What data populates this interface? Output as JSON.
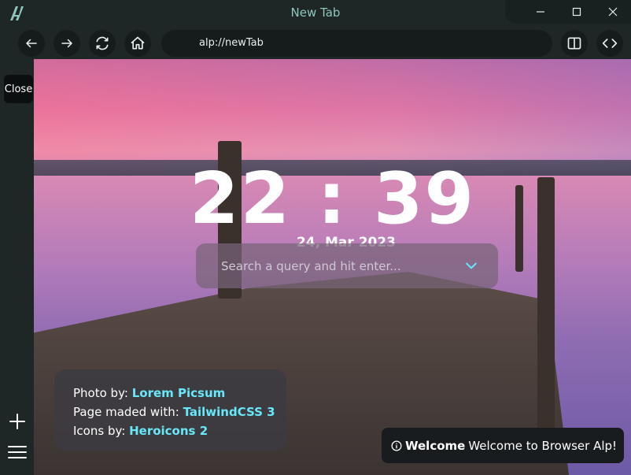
{
  "window": {
    "title": "New Tab"
  },
  "toolbar": {
    "url": "alp://newTab"
  },
  "sidebar": {
    "close_label": "Close"
  },
  "newtab": {
    "hours": "22",
    "separator": ":",
    "minutes": "39",
    "date": "24, Mar 2023",
    "search_placeholder": "Search a query and hit enter..."
  },
  "credits": {
    "photo_prefix": "Photo by:",
    "photo_link": "Lorem Picsum",
    "page_prefix": "Page maded with:",
    "page_link": "TailwindCSS 3",
    "icons_prefix": "Icons by:",
    "icons_link": "Heroicons 2"
  },
  "toast": {
    "title": "Welcome",
    "message": "Welcome to Browser Alp!"
  },
  "colors": {
    "accent": "#8ec7bc",
    "link": "#67e8f9",
    "chrome_bg": "#1f2626"
  }
}
